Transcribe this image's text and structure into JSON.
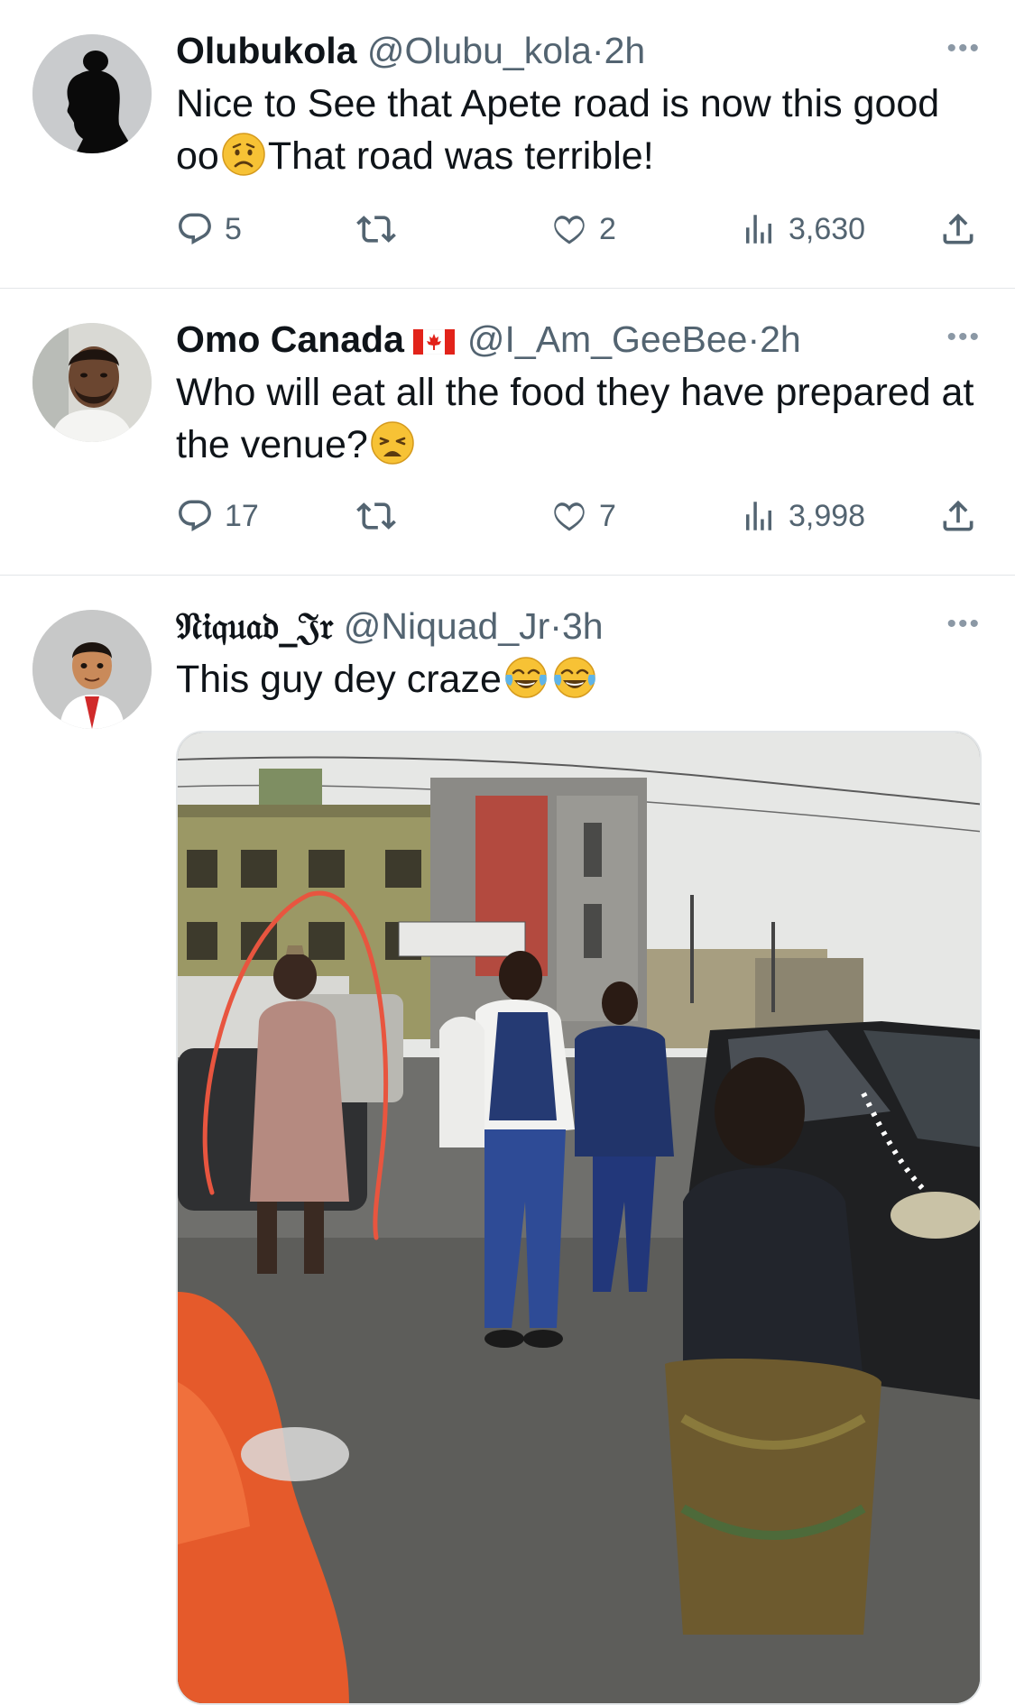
{
  "tweets": [
    {
      "name": "Olubukola",
      "handle": "@Olubu_kola",
      "dot": "·",
      "time": "2h",
      "text_before_emoji": "Nice to See that Apete road is now this good oo",
      "text_emoji": "worried-face",
      "text_after_emoji": "That road was terrible!",
      "replies": "5",
      "retweets": "",
      "likes": "2",
      "views": "3,630"
    },
    {
      "name": "Omo Canada",
      "name_flag": "canada-flag",
      "handle": "@I_Am_GeeBee",
      "dot": "·",
      "time": "2h",
      "text_before_emoji": "Who will eat all the food they have prepared at the venue?",
      "text_emoji": "weary-face",
      "replies": "17",
      "retweets": "",
      "likes": "7",
      "views": "3,998"
    },
    {
      "name": "𝔑𝔦𝔮𝔲𝔞𝔡_𝔍𝔯",
      "handle": "@Niquad_Jr",
      "dot": "·",
      "time": "3h",
      "text_before_emoji": "This guy dey craze",
      "text_emoji": "face-with-tears-of-joy",
      "media": "street-video-thumbnail"
    }
  ],
  "icons": {
    "more": "more-horizontal-icon",
    "reply": "reply-bubble-icon",
    "retweet": "retweet-icon",
    "like": "heart-icon",
    "views": "views-bar-chart-icon",
    "share": "share-upload-icon"
  },
  "colors": {
    "text": "#0f1419",
    "secondary": "#536471",
    "divider": "#e3e6e8",
    "annotation_red": "#e8553f"
  }
}
